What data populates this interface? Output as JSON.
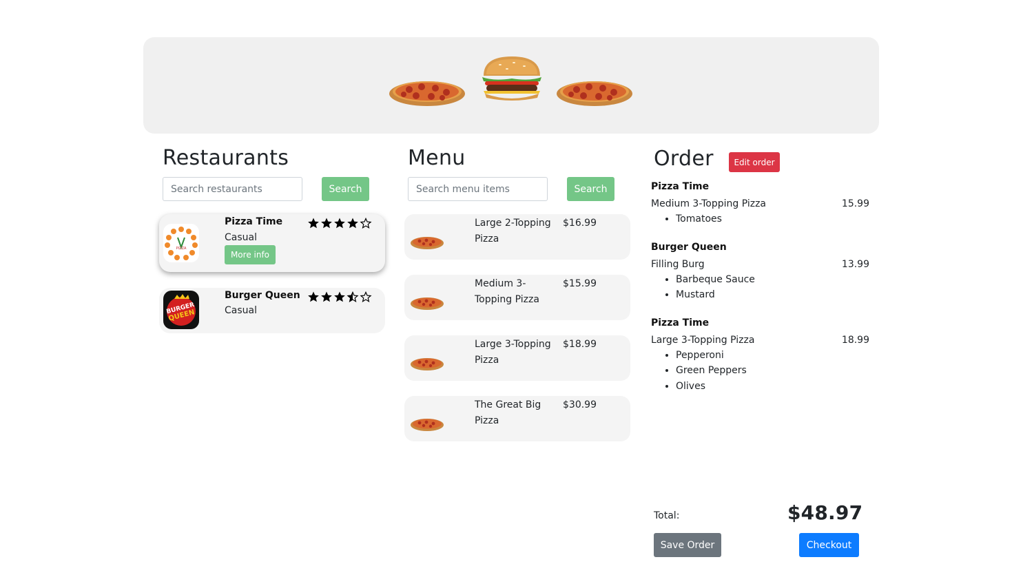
{
  "restaurants": {
    "title": "Restaurants",
    "search_placeholder": "Search restaurants",
    "search_label": "Search",
    "more_info_label": "More info",
    "items": [
      {
        "name": "Pizza Time",
        "type": "Casual",
        "rating": 4,
        "logo": "pizza-time-logo",
        "selected": true
      },
      {
        "name": "Burger Queen",
        "type": "Casual",
        "rating": 3.5,
        "logo": "burger-queen-logo",
        "selected": false
      }
    ]
  },
  "menu": {
    "title": "Menu",
    "search_placeholder": "Search menu items",
    "search_label": "Search",
    "items": [
      {
        "name": "Large 2-Topping Pizza",
        "price": "$16.99"
      },
      {
        "name": "Medium 3-Topping Pizza",
        "price": "$15.99"
      },
      {
        "name": "Large 3-Topping Pizza",
        "price": "$18.99"
      },
      {
        "name": "The Great Big Pizza",
        "price": "$30.99"
      }
    ]
  },
  "order": {
    "title": "Order",
    "edit_label": "Edit order",
    "groups": [
      {
        "restaurant": "Pizza Time",
        "item": "Medium 3-Topping Pizza",
        "price": "15.99",
        "toppings": [
          "Tomatoes"
        ]
      },
      {
        "restaurant": "Burger Queen",
        "item": "Filling Burg",
        "price": "13.99",
        "toppings": [
          "Barbeque Sauce",
          "Mustard"
        ]
      },
      {
        "restaurant": "Pizza Time",
        "item": "Large 3-Topping Pizza",
        "price": "18.99",
        "toppings": [
          "Pepperoni",
          "Green Peppers",
          "Olives"
        ]
      }
    ],
    "total_label": "Total:",
    "total": "$48.97",
    "save_label": "Save Order",
    "checkout_label": "Checkout"
  },
  "colors": {
    "success": "#74c687",
    "danger": "#dc3545",
    "secondary": "#6c757d",
    "primary": "#0d7cff"
  }
}
